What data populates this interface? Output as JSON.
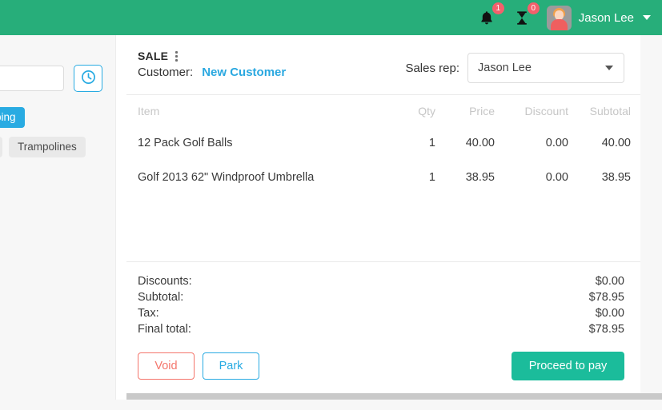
{
  "topbar": {
    "notifications": {
      "icon": "bell-icon",
      "count": "1"
    },
    "pending": {
      "icon": "hourglass-icon",
      "count": "0"
    },
    "user_name": "Jason Lee",
    "avatar_icon": "user-avatar",
    "caret_icon": "chevron-down-icon",
    "bg_color": "#27ae7a"
  },
  "left_panel": {
    "search_value": "",
    "search_placeholder": "",
    "history_icon": "clock-icon",
    "tags_row_1": [
      {
        "label": "Shipping",
        "style": "blue"
      }
    ],
    "tags_row_2": [
      {
        "label": "l",
        "style": "grey"
      },
      {
        "label": "Trampolines",
        "style": "grey"
      }
    ]
  },
  "card": {
    "sale_title": "SALE",
    "sale_menu_icon": "kebab-menu-icon",
    "customer_label": "Customer:",
    "customer_value": "New Customer",
    "sales_rep_label": "Sales rep:",
    "sales_rep_value": "Jason Lee",
    "sales_rep_caret_icon": "chevron-down-icon",
    "table": {
      "headers": {
        "item": "Item",
        "qty": "Qty",
        "price": "Price",
        "discount": "Discount",
        "subtotal": "Subtotal"
      },
      "rows": [
        {
          "item": "12 Pack Golf Balls",
          "qty": "1",
          "price": "40.00",
          "discount": "0.00",
          "subtotal": "40.00",
          "menu_icon": "kebab-menu-icon"
        },
        {
          "item": "Golf 2013 62\" Windproof Umbrella",
          "qty": "1",
          "price": "38.95",
          "discount": "0.00",
          "subtotal": "38.95",
          "menu_icon": "kebab-menu-icon"
        }
      ]
    },
    "totals": [
      {
        "label": "Discounts:",
        "value": "$0.00"
      },
      {
        "label": "Subtotal:",
        "value": "$78.95"
      },
      {
        "label": "Tax:",
        "value": "$0.00"
      },
      {
        "label": "Final total:",
        "value": "$78.95"
      }
    ],
    "buttons": {
      "void": "Void",
      "park": "Park",
      "pay": "Proceed to pay"
    },
    "colors": {
      "void": "#f4756b",
      "park": "#29abe2",
      "pay": "#1bbc9b",
      "link": "#2aa8e0"
    }
  }
}
